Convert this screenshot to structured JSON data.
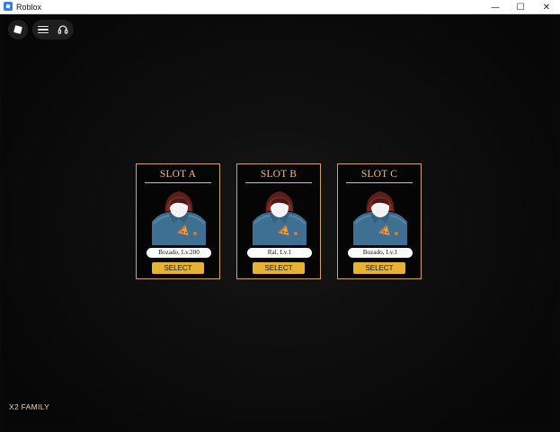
{
  "window": {
    "title": "Roblox",
    "controls": [
      "—",
      "☐",
      "✕"
    ]
  },
  "hud": {
    "menu_icon": "hamburger-icon",
    "voice_icon": "headphones-icon",
    "roblox_icon": "roblox-logo-icon"
  },
  "slots": [
    {
      "title": "SLOT A",
      "name": "Bozado, Lv.200",
      "select": "SELECT"
    },
    {
      "title": "SLOT B",
      "name": "Ral, Lv.1",
      "select": "SELECT"
    },
    {
      "title": "SLOT C",
      "name": "Bozado, Lv.1",
      "select": "SELECT"
    }
  ],
  "footer": {
    "label": "X2 FAMILY"
  },
  "colors": {
    "slot_border": "#d4a45c",
    "slot_title": "#ecc27a",
    "select_button": "#e6b236",
    "footer_text": "#f0d6a3"
  }
}
